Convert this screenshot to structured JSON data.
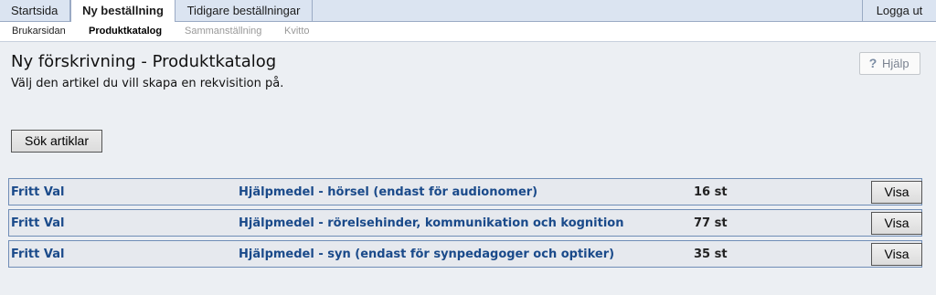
{
  "tabs": [
    {
      "label": "Startsida"
    },
    {
      "label": "Ny beställning"
    },
    {
      "label": "Tidigare beställningar"
    }
  ],
  "logout_label": "Logga ut",
  "subnav": [
    {
      "label": "Brukarsidan"
    },
    {
      "label": "Produktkatalog"
    },
    {
      "label": "Sammanställning"
    },
    {
      "label": "Kvitto"
    }
  ],
  "page": {
    "title": "Ny förskrivning - Produktkatalog",
    "subtitle": "Välj den artikel du vill skapa en rekvisition på.",
    "help_label": "Hjälp",
    "help_icon": "question-mark-icon",
    "search_label": "Sök artiklar"
  },
  "rows": [
    {
      "category": "Fritt Val",
      "description": "Hjälpmedel - hörsel (endast för audionomer)",
      "count": "16 st",
      "button": "Visa"
    },
    {
      "category": "Fritt Val",
      "description": "Hjälpmedel - rörelsehinder, kommunikation och kognition",
      "count": "77 st",
      "button": "Visa"
    },
    {
      "category": "Fritt Val",
      "description": "Hjälpmedel - syn (endast för synpedagoger och optiker)",
      "count": "35 st",
      "button": "Visa"
    }
  ],
  "colors": {
    "link": "#1a4a8a",
    "tabbar": "#dbe4f1",
    "row_border": "#6f8db6"
  }
}
